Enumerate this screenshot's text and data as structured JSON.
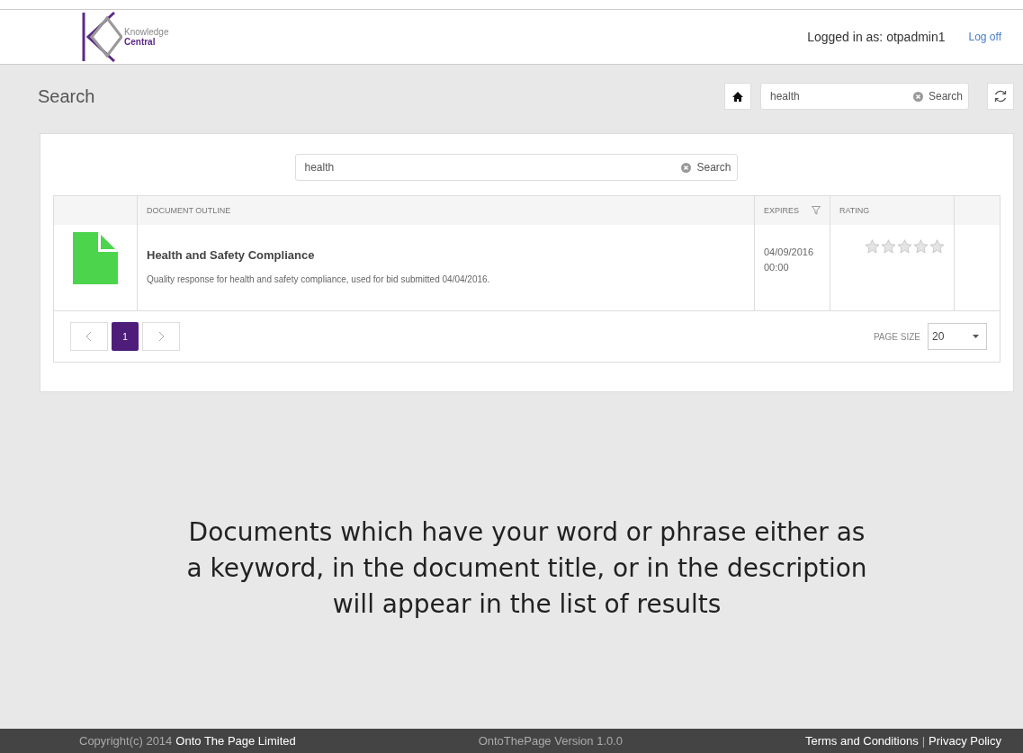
{
  "header": {
    "logo": {
      "line_1": "Knowledge",
      "line_2": "Central"
    },
    "user_label": "Logged in as: otpadmin1",
    "log_off": "Log off"
  },
  "page_title": "Search",
  "toolbar": {
    "search": {
      "value": "health",
      "button": "Search"
    }
  },
  "results": {
    "search": {
      "value": "health",
      "button": "Search"
    },
    "table": {
      "columns": [
        "DOCUMENT OUTLINE",
        "EXPIRES",
        "RATING"
      ],
      "rows": [
        {
          "title": "Health and Safety Compliance",
          "description": "Quality response for health and safety compliance, used for bid submitted 04/04/2016.",
          "expires": "04/09/2016\n00:00",
          "stars": 0
        }
      ]
    },
    "pager": {
      "pages": [
        {
          "label": "1",
          "selected": true
        }
      ],
      "page_size_label": "PAGE SIZE",
      "page_size": "20"
    }
  },
  "caption": "Documents which have your word or phrase either as a keyword, in the document title, or in the description will appear in the list of results",
  "footer": {
    "copyright": "Copyright(c) 2014",
    "company": "Onto The Page Limited",
    "version": "OntoThePage Version 1.0.0",
    "terms": "Terms and Conditions",
    "separator": "|",
    "privacy": "Privacy Policy"
  }
}
